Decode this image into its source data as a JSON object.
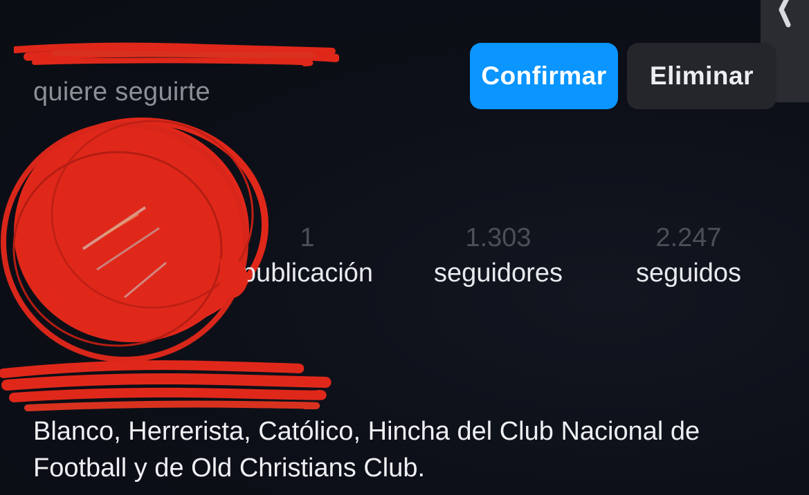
{
  "request": {
    "text": "quiere seguirte"
  },
  "actions": {
    "confirm_label": "Confirmar",
    "delete_label": "Eliminar"
  },
  "stats": [
    {
      "count": "1",
      "label": "publicación"
    },
    {
      "count": "1.303",
      "label": "seguidores"
    },
    {
      "count": "2.247",
      "label": "seguidos"
    }
  ],
  "bio": {
    "text": "Blanco, Herrerista, Católico, Hincha del Club Nacional de Football y de Old Christians Club."
  },
  "icons": {
    "back": "chevron-left-icon"
  },
  "colors": {
    "background": "#0c0f17",
    "accent": "#0a95ff",
    "redaction": "#e0281a",
    "muted_text": "#8c8f96"
  }
}
